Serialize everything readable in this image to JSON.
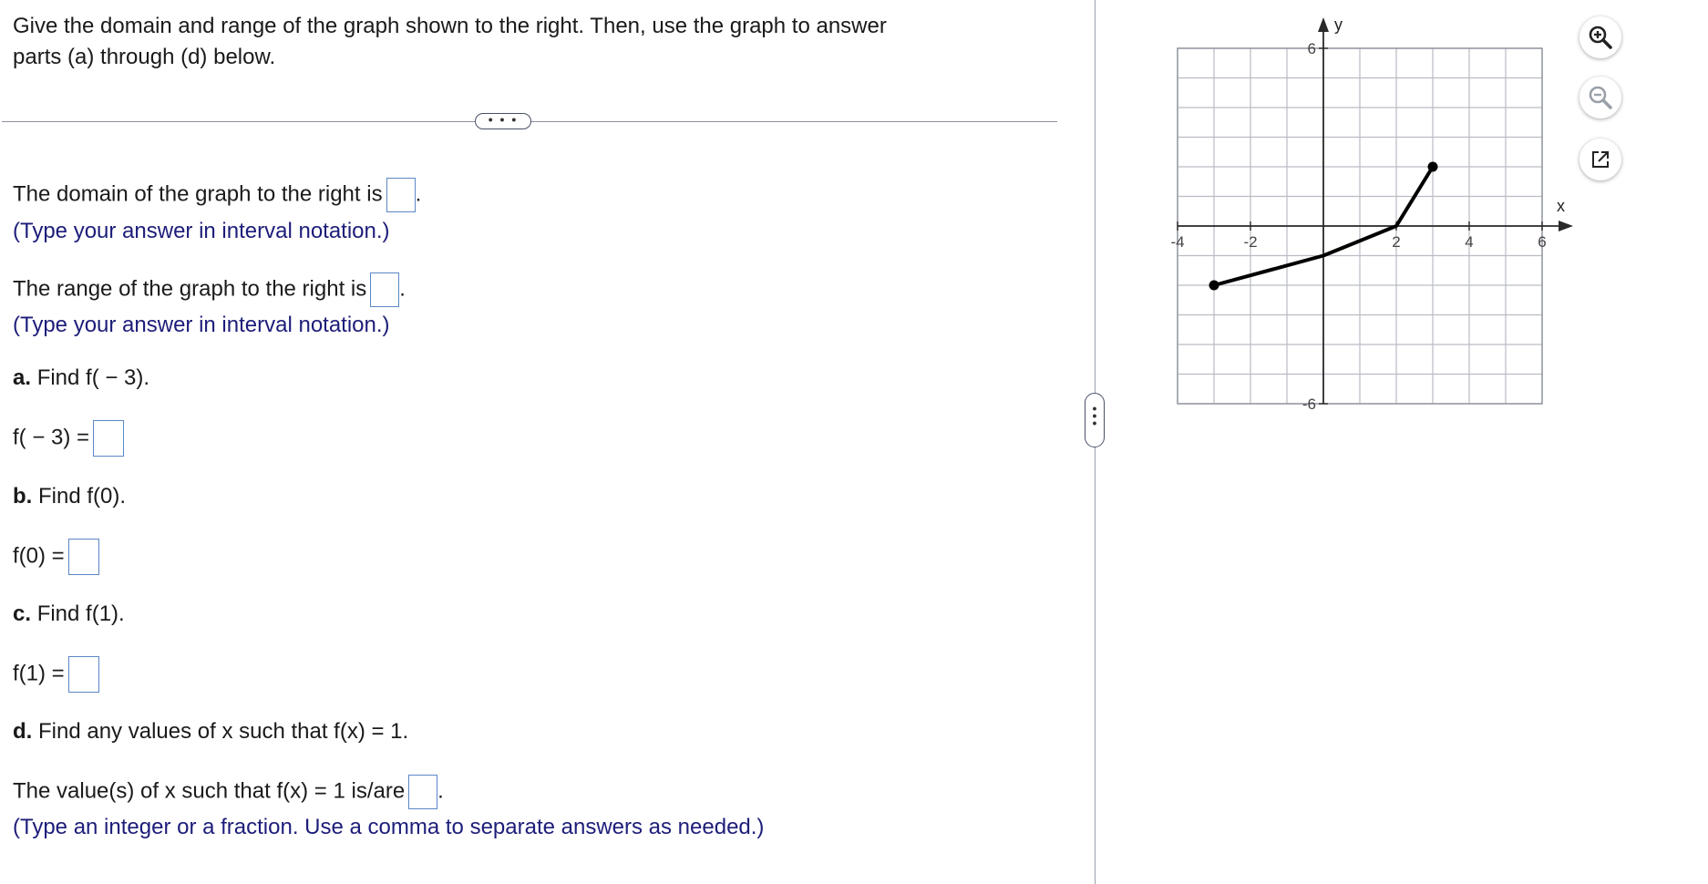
{
  "prompt": {
    "line1": "Give the domain and range of the graph shown to the right. Then, use the graph to answer",
    "line2": "parts (a) through (d) below."
  },
  "ellipsis": "• • •",
  "domain": {
    "text": "The domain of the graph to the right is",
    "end": ".",
    "hint": "(Type your answer in interval notation.)"
  },
  "range": {
    "text": "The range of the graph to the right is",
    "end": ".",
    "hint": "(Type your answer in interval notation.)"
  },
  "parts": {
    "a": {
      "letter": "a.",
      "question": "Find f( − 3).",
      "answer_label": "f( − 3) ="
    },
    "b": {
      "letter": "b.",
      "question": "Find f(0).",
      "answer_label": "f(0) ="
    },
    "c": {
      "letter": "c.",
      "question": "Find f(1).",
      "answer_label": "f(1) ="
    },
    "d": {
      "letter": "d.",
      "question": "Find any values of x such that f(x) = 1.",
      "answer_text": "The value(s) of x such that f(x) = 1 is/are",
      "end": ".",
      "hint": "(Type an integer or a fraction. Use a comma to separate answers as needed.)"
    }
  },
  "tools": {
    "zoom_in": "zoom-in-icon",
    "zoom_out": "zoom-out-icon",
    "popout": "open-in-new-window-icon"
  },
  "chart_data": {
    "type": "line",
    "xlabel": "x",
    "ylabel": "y",
    "xlim": [
      -4,
      6
    ],
    "ylim": [
      -6,
      6
    ],
    "grid": true,
    "x_ticks": [
      "-4",
      "-2",
      "2",
      "4",
      "6"
    ],
    "y_ticks": [
      "6",
      "-6"
    ],
    "series": [
      {
        "points": [
          [
            -3,
            -2
          ],
          [
            0,
            -1
          ],
          [
            2,
            0
          ],
          [
            3,
            2
          ]
        ],
        "endpoints": "closed"
      }
    ],
    "colors": {
      "grid": "#b9bcc4",
      "axis": "#2a2a2a",
      "curve": "#000000"
    }
  }
}
